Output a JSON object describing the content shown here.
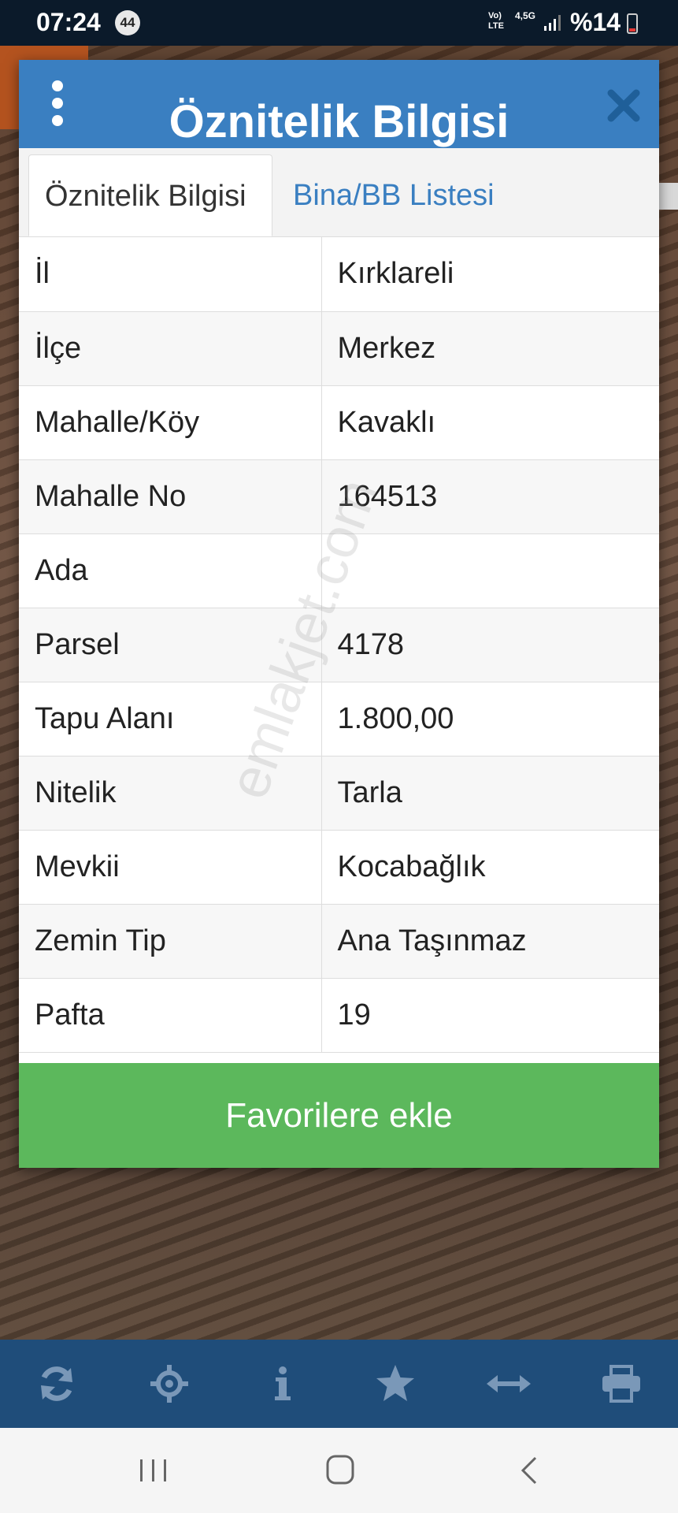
{
  "status_bar": {
    "time": "07:24",
    "notification_count": "44",
    "network_top": "Vo)",
    "network_bottom": "LTE",
    "network_speed": "4,5G",
    "battery": "%14"
  },
  "dialog": {
    "title": "Öznitelik Bilgisi",
    "tabs": [
      {
        "label": "Öznitelik Bilgisi",
        "active": true
      },
      {
        "label": "Bina/BB Listesi",
        "active": false
      }
    ],
    "rows": [
      {
        "key": "İl",
        "value": "Kırklareli"
      },
      {
        "key": "İlçe",
        "value": "Merkez"
      },
      {
        "key": "Mahalle/Köy",
        "value": "Kavaklı"
      },
      {
        "key": "Mahalle No",
        "value": "164513"
      },
      {
        "key": "Ada",
        "value": ""
      },
      {
        "key": "Parsel",
        "value": "4178"
      },
      {
        "key": "Tapu Alanı",
        "value": "1.800,00"
      },
      {
        "key": "Nitelik",
        "value": "Tarla"
      },
      {
        "key": "Mevkii",
        "value": "Kocabağlık"
      },
      {
        "key": "Zemin Tip",
        "value": "Ana Taşınmaz"
      },
      {
        "key": "Pafta",
        "value": "19"
      }
    ],
    "favorite_button": "Favorilere ekle",
    "watermark": "emlakjet.com"
  },
  "toolbar": {
    "icons": [
      "refresh-icon",
      "locate-icon",
      "info-icon",
      "star-icon",
      "measure-icon",
      "print-icon"
    ]
  },
  "colors": {
    "header": "#3a7fc1",
    "favorite": "#5cb85c",
    "toolbar": "#1f4d7a"
  }
}
